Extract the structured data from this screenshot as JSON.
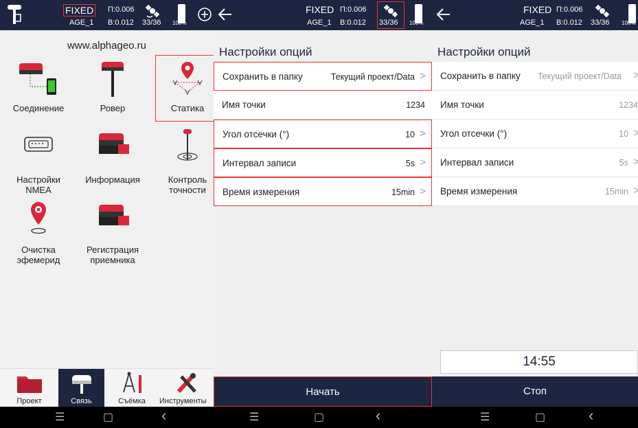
{
  "colors": {
    "primary": "#1d2540",
    "highlight": "#e33333",
    "device_red": "#d9263a",
    "background": "#efefef"
  },
  "status_bar": {
    "fix": "FIXED",
    "age": "AGE_1",
    "p_precision": "П:0.006",
    "b_precision": "B:0.012",
    "satellites": "33/36",
    "battery": "100%"
  },
  "panel1": {
    "url": "www.alphageo.ru",
    "grid": [
      {
        "label": "Соединение",
        "icon": "receiver-phone-icon"
      },
      {
        "label": "Ровер",
        "icon": "rover-icon"
      },
      {
        "label": "Статика",
        "icon": "static-map-pin-icon"
      },
      {
        "label": "Настройки NMEA",
        "icon": "serial-port-icon"
      },
      {
        "label": "Информация",
        "icon": "receiver-info-icon"
      },
      {
        "label": "Контроль точности",
        "icon": "accuracy-tripod-icon"
      },
      {
        "label": "Очистка эфемерид",
        "icon": "location-clear-icon"
      },
      {
        "label": "Регистрация приемника",
        "icon": "receiver-register-icon"
      }
    ],
    "tabs": [
      {
        "label": "Проект",
        "icon": "folder-icon"
      },
      {
        "label": "Связь",
        "icon": "receiver-icon"
      },
      {
        "label": "Съёмка",
        "icon": "compass-icon"
      },
      {
        "label": "Инструменты",
        "icon": "tools-icon"
      }
    ]
  },
  "settings": {
    "title": "Настройки опций",
    "rows": [
      {
        "label": "Сохранить в папку",
        "value": "Текущий проект/Data"
      },
      {
        "label": "Имя точки",
        "value": "1234"
      },
      {
        "label": "Угол отсечки (°)",
        "value": "10"
      },
      {
        "label": "Интервал записи",
        "value": "5s"
      },
      {
        "label": "Время измерения",
        "value": "15min"
      }
    ],
    "start_button": "Начать",
    "stop_button": "Стоп",
    "timer": "14:55"
  },
  "nav": {
    "menu": "☰",
    "home": "▢",
    "back": "‹"
  }
}
